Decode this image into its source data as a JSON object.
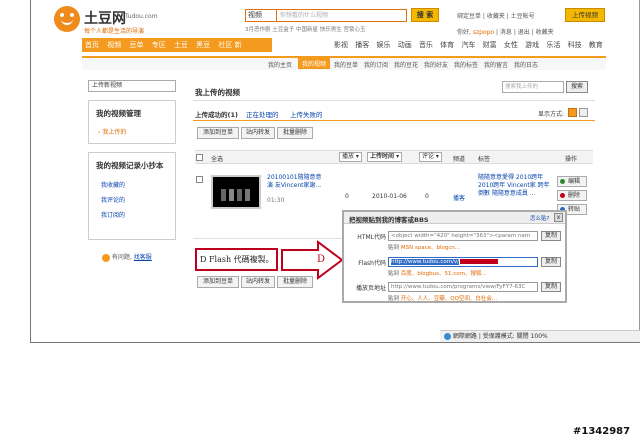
{
  "site": {
    "logo_text": "土豆网",
    "logo_domain": "Tudou.com",
    "slogan": "每个人都是生活的导演"
  },
  "search": {
    "type": "视频",
    "placeholder": "你想看的什么视频",
    "button": "搜 索",
    "hot_words": "3月恶作剧  土豆盒子  中国新星  快乐男生  宫锁心玉"
  },
  "top_links": "绑定豆单 | 收藏夹 | 土豆帐号",
  "upload_button": "上传视频",
  "welcome": {
    "greeting": "你好,",
    "username": "szpopo",
    "rest": "| 消息 | 退出 | 收藏夹"
  },
  "nav": {
    "orange_items": [
      "首页",
      "视频",
      "豆单",
      "专区",
      "土豆",
      "黑豆",
      "社区 新"
    ],
    "right_items": [
      "影视",
      "播客",
      "娱乐",
      "动画",
      "音乐",
      "体育",
      "汽车",
      "财富",
      "女性",
      "游戏",
      "乐活",
      "科技",
      "教育"
    ]
  },
  "subnav": {
    "items": [
      "我的主页",
      "我的视频",
      "我的豆单",
      "我的订阅",
      "我的豆花",
      "我的好友",
      "我的标签",
      "我的留言",
      "我的日志"
    ],
    "active_index": 1
  },
  "sidebar": {
    "select_label": "上传新视频",
    "box1_title": "我的视频管理",
    "box1_items": [
      "我上传的"
    ],
    "box2_title": "我的视频记录小抄本",
    "box2_items": [
      "我收藏的",
      "我评论的",
      "我订阅的"
    ],
    "help_text": "有问题,",
    "help_link": "找客服"
  },
  "main": {
    "title": "我上传的视频",
    "search_placeholder": "搜索我上传的",
    "search_button": "搜索",
    "display_mode_label": "显示方式:",
    "tabs": [
      {
        "label": "上传成功的(1)",
        "active": true
      },
      {
        "label": "正在处理的",
        "active": false
      },
      {
        "label": "上传失败的",
        "active": false
      }
    ],
    "actions": [
      "添加到豆单",
      "站内转发",
      "批量删除"
    ],
    "columns": {
      "select_all": "全选",
      "play": "播放",
      "upload_time": "上传时间",
      "comments": "评论",
      "channel": "频道",
      "tags": "标签",
      "ops": "操作"
    },
    "video": {
      "title": "20100101隨隨意意演 友Vincent家謝...",
      "duration": "01:30",
      "plays": "0",
      "date": "2010-01-06",
      "comments": "0",
      "channel": "播客",
      "tags": "隨隨意意愛得 2010跨年 2010跨年 Vincent家 跨年倒數 隨隨意意成員 ...",
      "ops": [
        "编辑",
        "删除",
        "转贴"
      ]
    }
  },
  "popup": {
    "title": "把视频贴到我的博客或BBS",
    "help_link": "怎么贴?",
    "close": "x",
    "rows": [
      {
        "label": "HTML代码",
        "value": "<object width=\"420\" height=\"363\"><param nam",
        "copy": "复制",
        "hint_prefix": "贴到",
        "hint_links": "MSN space、blogcn..."
      },
      {
        "label": "Flash代码",
        "value": "http://www.tudou.com/v/",
        "copy": "复制",
        "hint_prefix": "贴到",
        "hint_links": "百度、blogbus、51.com、搜狐..."
      },
      {
        "label": "播放页地址",
        "value": "http://www.tudou.com/programs/view/FyFY7-63C",
        "copy": "复制",
        "hint_prefix": "贴到",
        "hint_links": "开心、人人、豆瓣、QQ空间、白社会..."
      }
    ]
  },
  "annotation": {
    "box_text": "D Flash 代碼複製。",
    "letter": "D"
  },
  "statusbar": "網際網路 | 受保護模式: 關閉        100%",
  "watermark": "#1342987"
}
